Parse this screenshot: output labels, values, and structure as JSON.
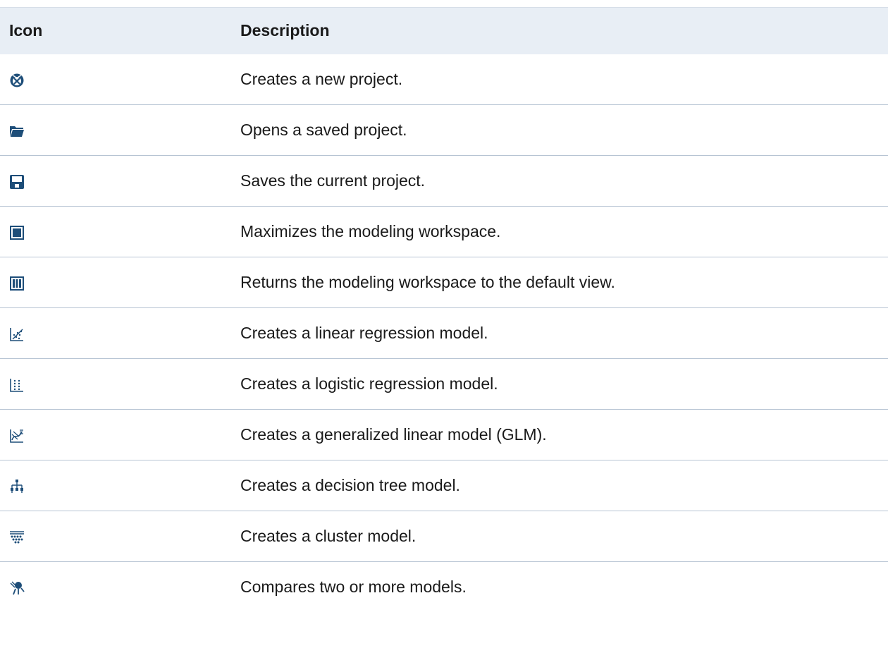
{
  "header": {
    "icon_label": "Icon",
    "description_label": "Description"
  },
  "rows": [
    {
      "icon": "new-project-icon",
      "description": "Creates a new project."
    },
    {
      "icon": "folder-open-icon",
      "description": "Opens a saved project."
    },
    {
      "icon": "save-icon",
      "description": "Saves the current project."
    },
    {
      "icon": "maximize-icon",
      "description": "Maximizes the modeling workspace."
    },
    {
      "icon": "restore-view-icon",
      "description": "Returns the modeling workspace to the default view."
    },
    {
      "icon": "linear-regression-icon",
      "description": "Creates a linear regression model."
    },
    {
      "icon": "logistic-regression-icon",
      "description": "Creates a logistic regression model."
    },
    {
      "icon": "glm-icon",
      "description": "Creates a generalized linear model (GLM)."
    },
    {
      "icon": "decision-tree-icon",
      "description": "Creates a decision tree model."
    },
    {
      "icon": "cluster-icon",
      "description": "Creates a cluster model."
    },
    {
      "icon": "compare-models-icon",
      "description": "Compares two or more models."
    }
  ],
  "colors": {
    "icon_blue": "#1e4e79",
    "header_bg": "#e8eef5",
    "divider": "#b7c4d3"
  }
}
